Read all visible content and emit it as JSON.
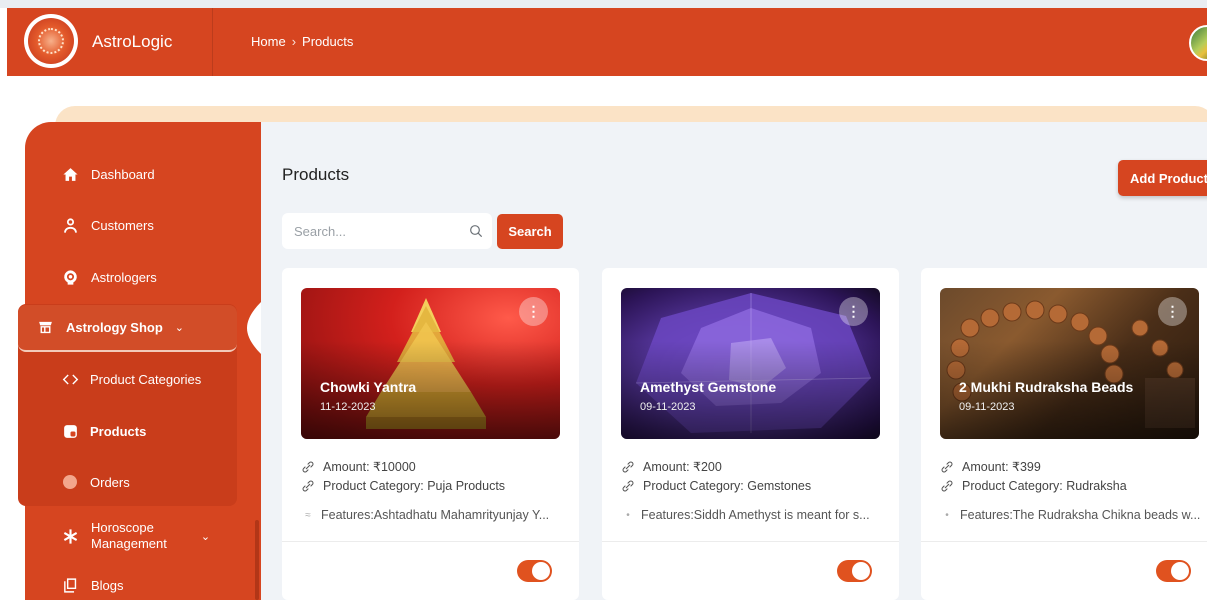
{
  "app": {
    "name": "AstroLogic"
  },
  "breadcrumb": {
    "home": "Home",
    "separator": "›",
    "current": "Products"
  },
  "sidebar": {
    "items": [
      {
        "label": "Dashboard",
        "icon": "home-icon"
      },
      {
        "label": "Customers",
        "icon": "user-icon"
      },
      {
        "label": "Astrologers",
        "icon": "astrologer-icon"
      },
      {
        "label": "Astrology Shop",
        "icon": "shop-icon"
      },
      {
        "label": "Horoscope Management",
        "icon": "asterisk-icon"
      },
      {
        "label": "Blogs",
        "icon": "blogs-icon"
      }
    ],
    "horoscope_line1": "Horoscope",
    "horoscope_line2": "Management",
    "shop_submenu": [
      {
        "label": "Product Categories",
        "icon": "categories-icon"
      },
      {
        "label": "Products",
        "icon": "products-icon",
        "active": true
      },
      {
        "label": "Orders",
        "icon": "orders-icon"
      }
    ]
  },
  "page": {
    "title": "Products",
    "add_button": "Add Product",
    "search_placeholder": "Search...",
    "search_button": "Search"
  },
  "products": [
    {
      "name": "Chowki Yantra",
      "date": "11-12-2023",
      "amount": "Amount: ₹10000",
      "category": "Product Category: Puja Products",
      "features": "Features:Ashtadhatu Mahamrityunjay Y...",
      "enabled": true
    },
    {
      "name": "Amethyst Gemstone",
      "date": "09-11-2023",
      "amount": "Amount: ₹200",
      "category": "Product Category: Gemstones",
      "features": "Features:Siddh Amethyst is meant for s...",
      "enabled": true
    },
    {
      "name": "2 Mukhi Rudraksha Beads",
      "date": "09-11-2023",
      "amount": "Amount: ₹399",
      "category": "Product Category: Rudraksha",
      "features": "Features:The Rudraksha Chikna beads w...",
      "enabled": true
    }
  ],
  "colors": {
    "brand": "#d64520",
    "brand_dark": "#c93d1b",
    "banner": "#fbe3c6",
    "background": "#f0f3f7",
    "toggle_on": "#e0521f"
  }
}
